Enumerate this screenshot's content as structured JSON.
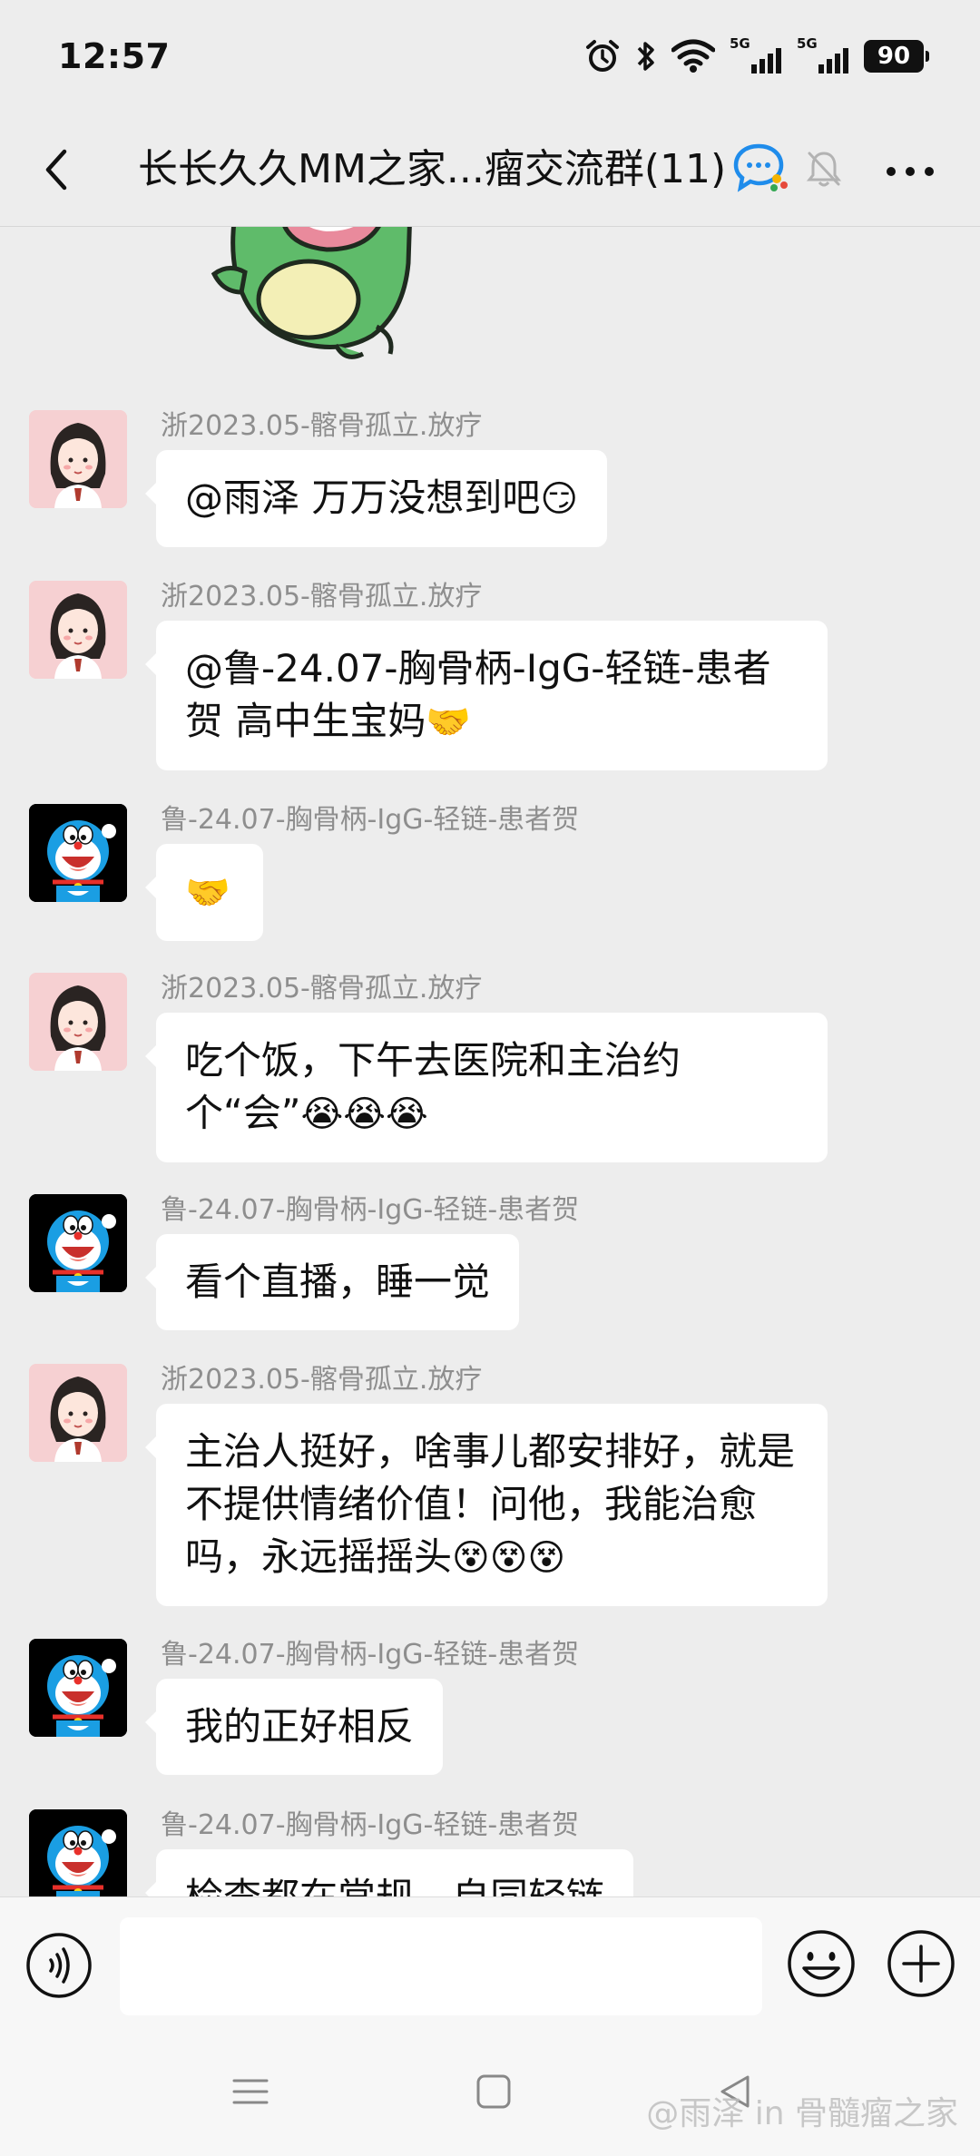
{
  "status_bar": {
    "time": "12:57",
    "network_label": "5G",
    "network_label_2": "5G",
    "battery": "90"
  },
  "header": {
    "title": "长长久久MM之家...瘤交流群(11)",
    "back_icon": "chevron-left-icon",
    "group_icon": "group-chat-icon",
    "mute_icon": "bell-muted-icon",
    "more_icon": "more-dots-icon"
  },
  "messages": [
    {
      "sender": "浙2023.05-髂骨孤立.放疗",
      "text": "@雨泽  万万没想到吧",
      "emoji": "😏",
      "avatar": "girl-avatar"
    },
    {
      "sender": "浙2023.05-髂骨孤立.放疗",
      "text": "@鲁-24.07-胸骨柄-IgG-轻链-患者贺  高中生宝妈",
      "emoji": "🤝",
      "avatar": "girl-avatar"
    },
    {
      "sender": "鲁-24.07-胸骨柄-IgG-轻链-患者贺",
      "text": "",
      "emoji": "🤝",
      "avatar": "doraemon-avatar"
    },
    {
      "sender": "浙2023.05-髂骨孤立.放疗",
      "text": "吃个饭，下午去医院和主治约个“会”",
      "emoji": "😭😭😭",
      "avatar": "girl-avatar"
    },
    {
      "sender": "鲁-24.07-胸骨柄-IgG-轻链-患者贺",
      "text": "看个直播，睡一觉",
      "emoji": "",
      "avatar": "doraemon-avatar"
    },
    {
      "sender": "浙2023.05-髂骨孤立.放疗",
      "text": "主治人挺好，啥事儿都安排好，就是不提供情绪价值！问他，我能治愈吗，永远摇摇头",
      "emoji": "😵😵😵",
      "avatar": "girl-avatar"
    },
    {
      "sender": "鲁-24.07-胸骨柄-IgG-轻链-患者贺",
      "text": "我的正好相反",
      "emoji": "",
      "avatar": "doraemon-avatar"
    },
    {
      "sender": "鲁-24.07-胸骨柄-IgG-轻链-患者贺",
      "text": "检查都在常规，自同轻链",
      "emoji": "",
      "avatar": "doraemon-avatar"
    }
  ],
  "input_bar": {
    "voice_icon": "voice-icon",
    "emoji_icon": "smiley-icon",
    "plus_icon": "plus-circle-icon",
    "placeholder": ""
  },
  "system_nav": {
    "menu_icon": "menu-icon",
    "home_icon": "square-home-icon",
    "back_icon": "triangle-back-icon"
  },
  "watermark": "@雨泽 in 骨髓瘤之家"
}
